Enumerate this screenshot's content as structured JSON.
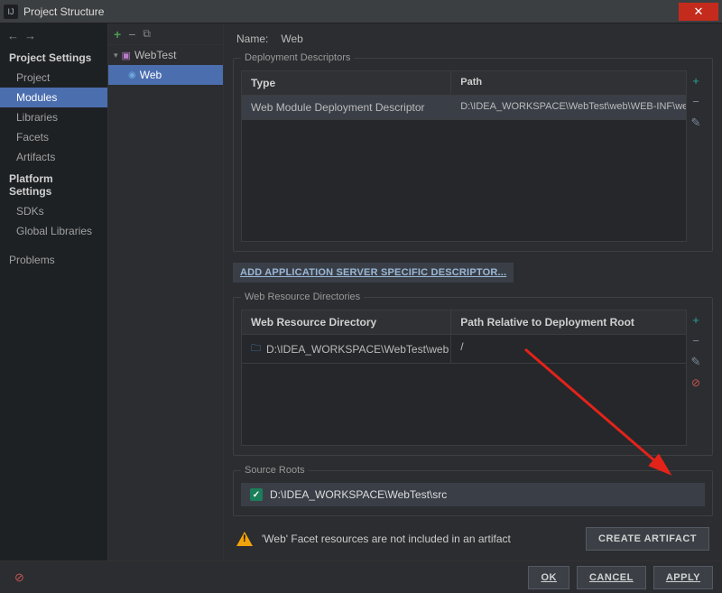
{
  "window": {
    "title": "Project Structure",
    "icon_text": "IJ"
  },
  "sidebar": {
    "headings": {
      "project": "Project Settings",
      "platform": "Platform Settings"
    },
    "project_items": [
      "Project",
      "Modules",
      "Libraries",
      "Facets",
      "Artifacts"
    ],
    "platform_items": [
      "SDKs",
      "Global Libraries"
    ],
    "problems": "Problems",
    "selected": "Modules"
  },
  "tree": {
    "module": "WebTest",
    "facet": "Web"
  },
  "main": {
    "name_label": "Name:",
    "name_value": "Web",
    "deploy_section": "Deployment Descriptors",
    "deploy_head": {
      "type": "Type",
      "path": "Path"
    },
    "deploy_row": {
      "type": "Web Module Deployment Descriptor",
      "path": "D:\\IDEA_WORKSPACE\\WebTest\\web\\WEB-INF\\web.xml"
    },
    "link": "ADD APPLICATION SERVER SPECIFIC DESCRIPTOR...",
    "res_section": "Web Resource Directories",
    "res_head": {
      "col1": "Web Resource Directory",
      "col2": "Path Relative to Deployment Root"
    },
    "res_row": {
      "dir": "D:\\IDEA_WORKSPACE\\WebTest\\web",
      "rel": "/"
    },
    "src_section": "Source Roots",
    "src_path": "D:\\IDEA_WORKSPACE\\WebTest\\src",
    "warning": "'Web' Facet resources are not included in an artifact",
    "create_artifact": "CREATE ARTIFACT"
  },
  "buttons": {
    "ok": "OK",
    "cancel": "CANCEL",
    "apply": "APPLY"
  }
}
